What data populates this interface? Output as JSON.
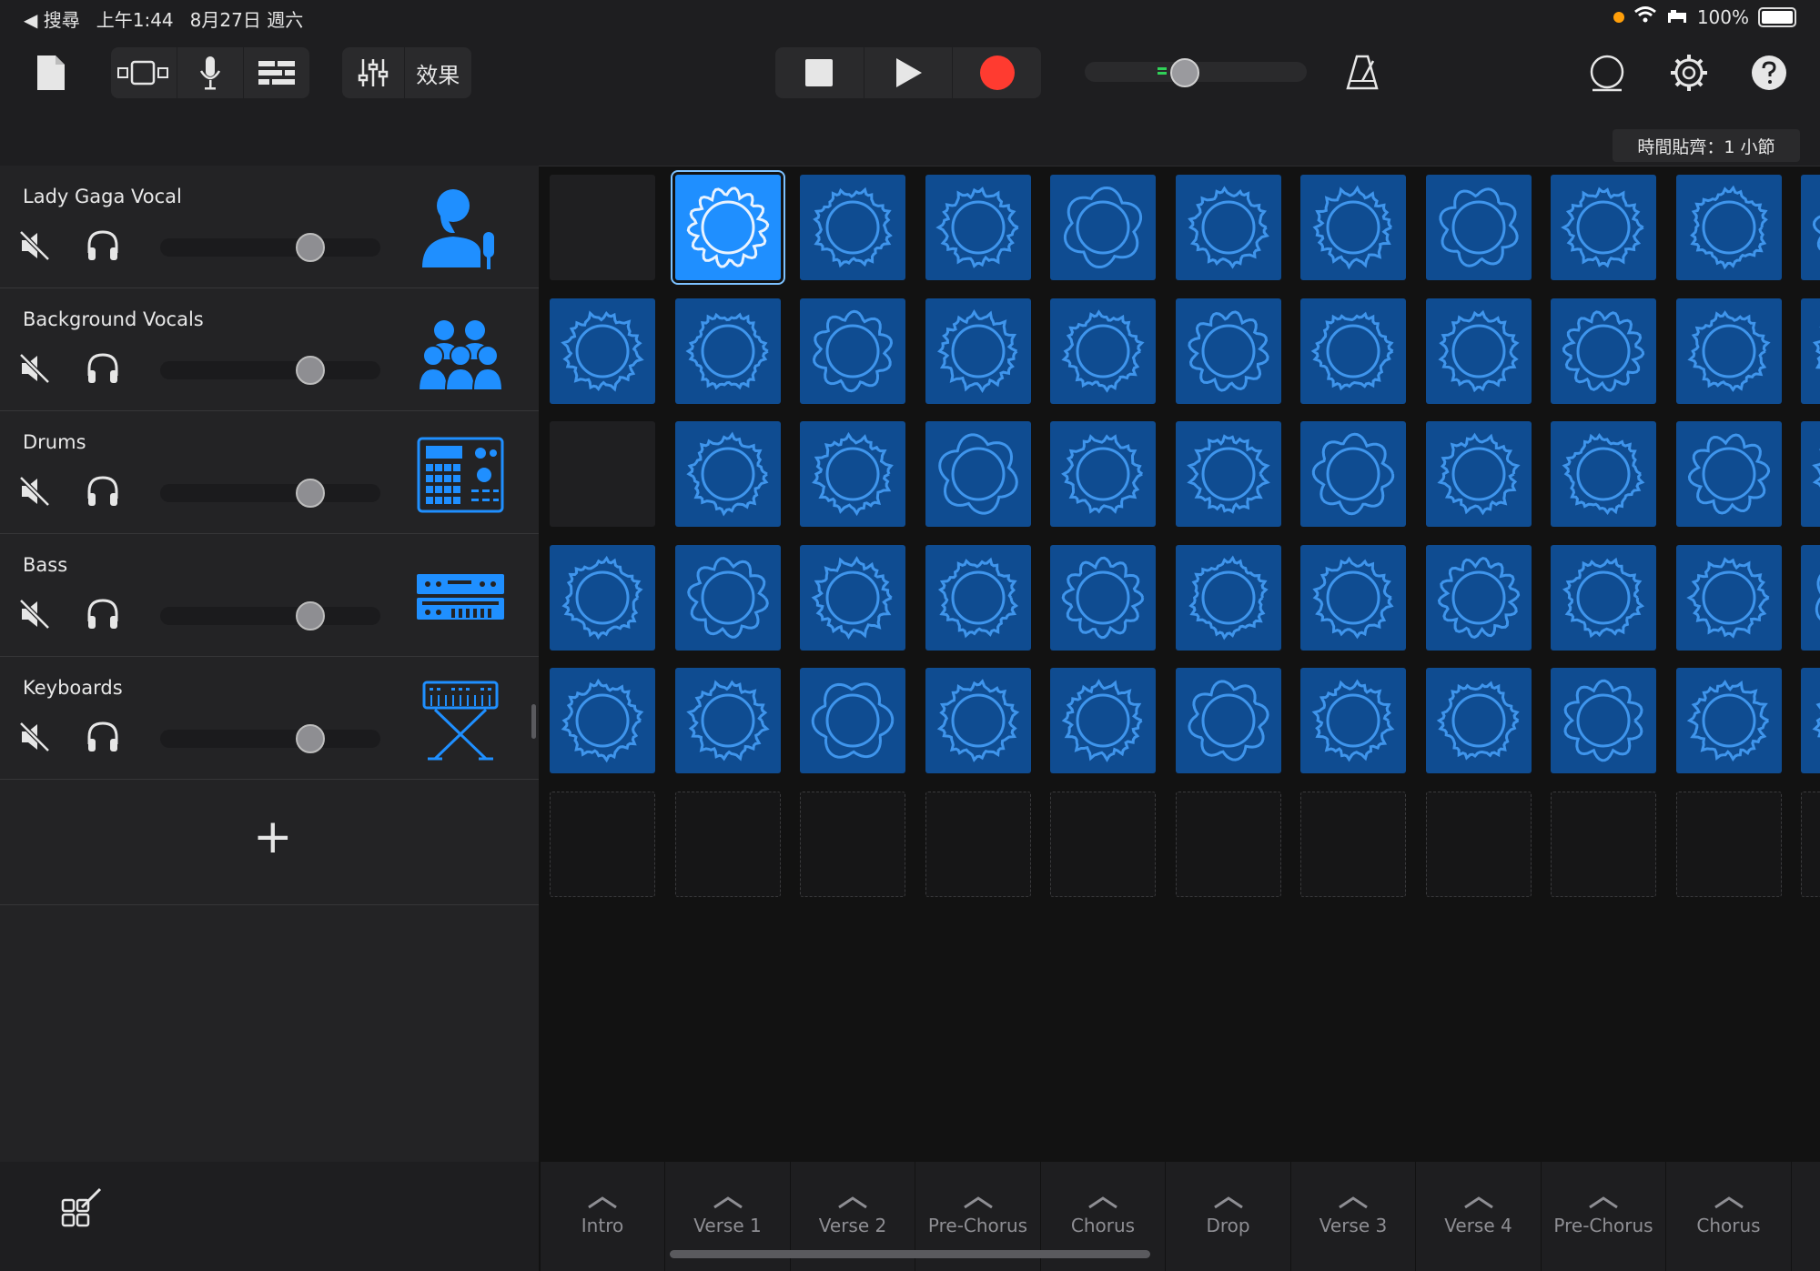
{
  "status_bar": {
    "back_label": "◀ 搜尋",
    "time": "上午1:44",
    "date": "8月27日 週六",
    "battery": "100%"
  },
  "toolbar": {
    "effects_label": "效果",
    "snap_label": "時間貼齊：1 小節"
  },
  "tracks": [
    {
      "name": "Lady Gaga Vocal",
      "instrument_icon": "singer-icon",
      "volume": 0.7
    },
    {
      "name": "Background Vocals",
      "instrument_icon": "choir-icon",
      "volume": 0.7
    },
    {
      "name": "Drums",
      "instrument_icon": "drum-machine-icon",
      "volume": 0.7
    },
    {
      "name": "Bass",
      "instrument_icon": "bass-amp-icon",
      "volume": 0.7
    },
    {
      "name": "Keyboards",
      "instrument_icon": "keyboard-stand-icon",
      "volume": 0.7
    }
  ],
  "add_track_label": "+",
  "grid": {
    "rows": [
      [
        "empty",
        "selected",
        "filled",
        "filled",
        "filled",
        "filled",
        "filled",
        "filled",
        "filled",
        "filled",
        "filled"
      ],
      [
        "filled",
        "filled",
        "filled",
        "filled",
        "filled",
        "filled",
        "filled",
        "filled",
        "filled",
        "filled",
        "filled"
      ],
      [
        "empty",
        "filled",
        "filled",
        "filled",
        "filled",
        "filled",
        "filled",
        "filled",
        "filled",
        "filled",
        "filled"
      ],
      [
        "filled",
        "filled",
        "filled",
        "filled",
        "filled",
        "filled",
        "filled",
        "filled",
        "filled",
        "filled",
        "filled"
      ],
      [
        "filled",
        "filled",
        "filled",
        "filled",
        "filled",
        "filled",
        "filled",
        "filled",
        "filled",
        "filled",
        "filled"
      ],
      [
        "placeholder",
        "placeholder",
        "placeholder",
        "placeholder",
        "placeholder",
        "placeholder",
        "placeholder",
        "placeholder",
        "placeholder",
        "placeholder",
        "placeholder"
      ]
    ]
  },
  "scenes": [
    "Intro",
    "Verse 1",
    "Verse 2",
    "Pre-Chorus",
    "Chorus",
    "Drop",
    "Verse 3",
    "Verse 4",
    "Pre-Chorus",
    "Chorus"
  ],
  "colors": {
    "cell": "#0f4c91",
    "wave": "#3f95ec",
    "record": "#ff3b30",
    "accent": "#1f8fff"
  }
}
